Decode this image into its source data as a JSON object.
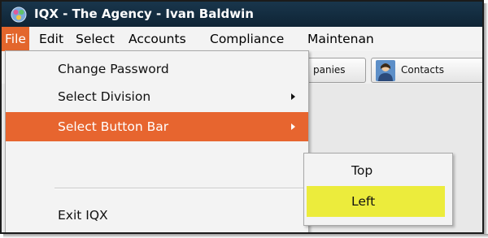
{
  "window": {
    "title": "IQX - The Agency - Ivan Baldwin",
    "icon": "app-logo-icon"
  },
  "menubar": {
    "items": [
      "File",
      "Edit",
      "Select",
      "Accounts",
      "Compliance",
      "Maintenan"
    ],
    "active": "File"
  },
  "toolbar": {
    "buttons": [
      {
        "label": "panies"
      },
      {
        "label": "Contacts",
        "icon": "contact-person-icon"
      }
    ]
  },
  "file_menu": {
    "items": [
      {
        "label": "Change Password"
      },
      {
        "label": "Select Division",
        "has_submenu": true
      },
      {
        "label": "Select Button Bar",
        "has_submenu": true,
        "highlighted": true
      },
      {
        "label": "Exit IQX"
      }
    ]
  },
  "button_bar_submenu": {
    "items": [
      {
        "label": "Top"
      },
      {
        "label": "Left",
        "highlighted": true
      }
    ]
  },
  "colors": {
    "titlebar": "#19364c",
    "menu_highlight": "#e7652f",
    "submenu_highlight": "#ecec3c"
  }
}
